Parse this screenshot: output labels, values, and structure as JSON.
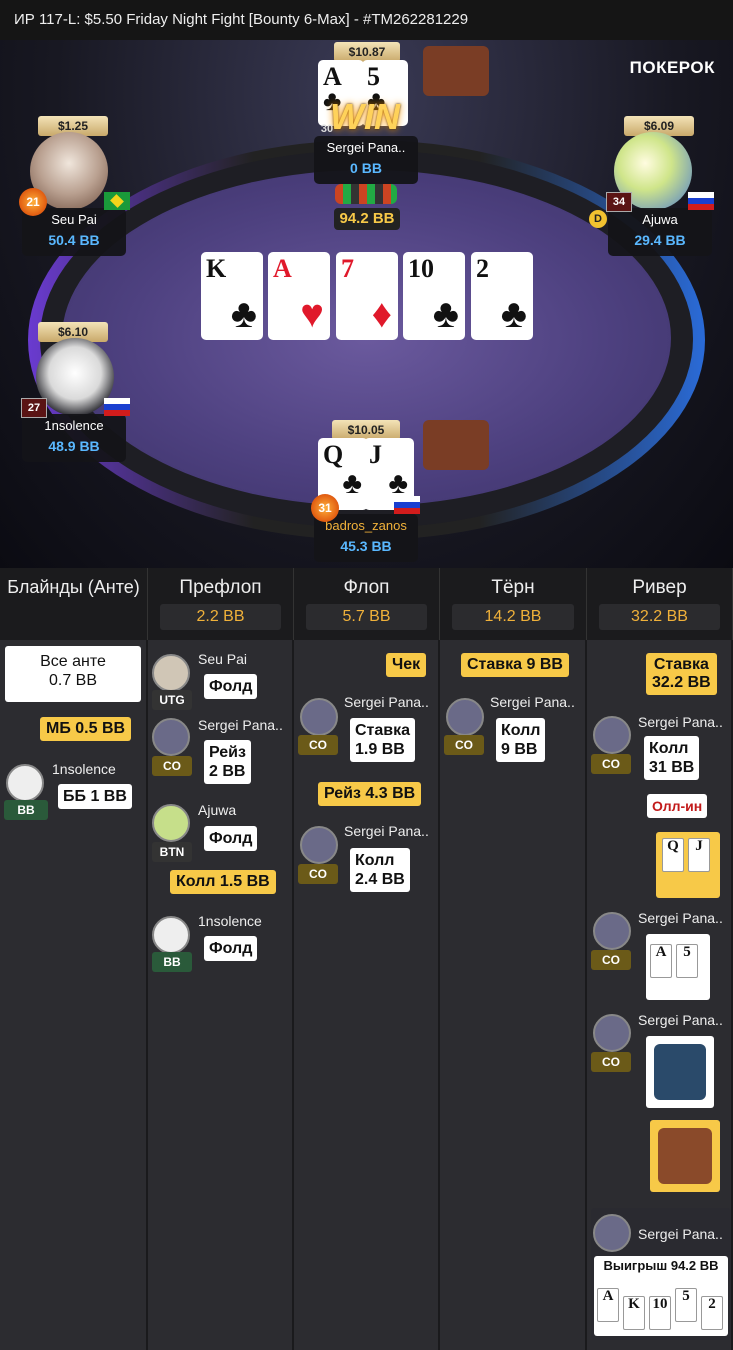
{
  "title": "ИР  117-L: $5.50 Friday Night Fight [Bounty 6-Max]   - #TM262281229",
  "logo": "ПОКЕРОК",
  "win_text": "WIN",
  "pot_bb": "94.2 BB",
  "board": [
    {
      "rank": "K",
      "suit": "♣",
      "red": false
    },
    {
      "rank": "A",
      "suit": "♥",
      "red": true
    },
    {
      "rank": "7",
      "suit": "♦",
      "red": true
    },
    {
      "rank": "10",
      "suit": "♣",
      "red": false
    },
    {
      "rank": "2",
      "suit": "♣",
      "red": false
    }
  ],
  "players": {
    "sergei": {
      "stack": "$10.87",
      "name": "Sergei Pana..",
      "bb": "0 BB",
      "level": "30",
      "cards": [
        {
          "rank": "A",
          "suit": "♣"
        },
        {
          "rank": "5",
          "suit": "♣"
        }
      ]
    },
    "seupai": {
      "stack": "$1.25",
      "name": "Seu Pai",
      "bb": "50.4 BB",
      "level": "21"
    },
    "ajuwa": {
      "stack": "$6.09",
      "name": "Ajuwa",
      "bb": "29.4 BB",
      "level": "34",
      "dealer": "D"
    },
    "insolence": {
      "stack": "$6.10",
      "name": "1nsolence",
      "bb": "48.9 BB",
      "level": "27"
    },
    "badros": {
      "stack": "$10.05",
      "name": "badros_zanos",
      "bb": "45.3 BB",
      "level": "31",
      "cards": [
        {
          "rank": "Q",
          "suit": "♣"
        },
        {
          "rank": "J",
          "suit": "♣"
        }
      ]
    }
  },
  "history": {
    "columns": [
      {
        "title": "Блайнды (Анте)",
        "pot": ""
      },
      {
        "title": "Префлоп",
        "pot": "2.2 BB"
      },
      {
        "title": "Флоп",
        "pot": "5.7 BB"
      },
      {
        "title": "Тёрн",
        "pot": "14.2 BB"
      },
      {
        "title": "Ривер",
        "pot": "32.2 BB"
      }
    ],
    "blinds": {
      "all_ante": "Все анте\n0.7 BB",
      "sb": "МБ 0.5 BB",
      "bb_player": "1nsolence",
      "bb_pos": "BB",
      "bb_action": "ББ 1 BB"
    },
    "preflop": [
      {
        "name": "Seu Pai",
        "pos": "UTG",
        "action": "Фолд"
      },
      {
        "name": "Sergei Pana..",
        "pos": "CO",
        "action": "Рейз\n2 BB"
      },
      {
        "name": "Ajuwa",
        "pos": "BTN",
        "action": "Фолд"
      },
      {
        "call": "Колл 1.5 BB"
      },
      {
        "name": "1nsolence",
        "pos": "BB",
        "action": "Фолд"
      }
    ],
    "flop": {
      "check": "Чек",
      "a1_name": "Sergei Pana..",
      "a1_pos": "CO",
      "a1_action": "Ставка\n1.9 BB",
      "raise": "Рейз 4.3 BB",
      "a2_name": "Sergei Pana..",
      "a2_pos": "CO",
      "a2_action": "Колл\n2.4 BB"
    },
    "turn": {
      "bet": "Ставка 9 BB",
      "a1_name": "Sergei Pana..",
      "a1_pos": "CO",
      "a1_action": "Колл\n9 BB"
    },
    "river": {
      "bet": "Ставка\n32.2 BB",
      "a1_name": "Sergei Pana..",
      "a1_pos": "CO",
      "a1_action": "Колл\n31 BB",
      "allin": "Олл-ин",
      "show_cards": [
        "Q",
        "J"
      ],
      "a2_name": "Sergei Pana..",
      "a2_pos": "CO",
      "a2_cards": [
        "A",
        "5"
      ],
      "a3_name": "Sergei Pana..",
      "a3_pos": "CO",
      "winner_name": "Sergei Pana..",
      "winner_text": "Выигрыш 94.2 BB",
      "winner_cards": [
        "A",
        "K",
        "10",
        "5",
        "2"
      ]
    }
  }
}
